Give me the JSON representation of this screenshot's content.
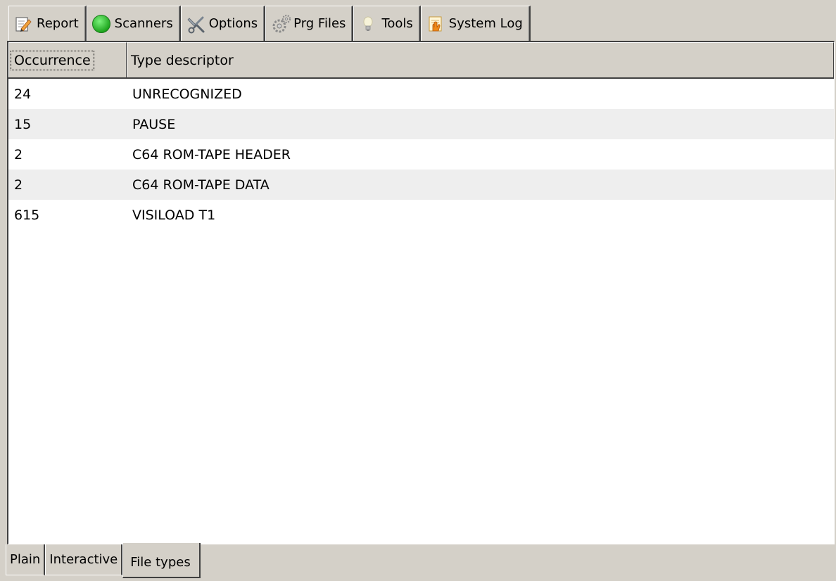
{
  "top_tabs": [
    {
      "label": "Report",
      "icon": "report-icon"
    },
    {
      "label": "Scanners",
      "icon": "scanners-icon"
    },
    {
      "label": "Options",
      "icon": "options-icon"
    },
    {
      "label": "Prg Files",
      "icon": "prg-files-icon"
    },
    {
      "label": "Tools",
      "icon": "tools-icon"
    },
    {
      "label": "System Log",
      "icon": "system-log-icon"
    }
  ],
  "table": {
    "headers": {
      "occurrence": "Occurrence",
      "type": "Type descriptor"
    },
    "rows": [
      {
        "occurrence": "24",
        "type": "UNRECOGNIZED"
      },
      {
        "occurrence": "15",
        "type": "PAUSE"
      },
      {
        "occurrence": "2",
        "type": "C64 ROM-TAPE HEADER"
      },
      {
        "occurrence": "2",
        "type": "C64 ROM-TAPE DATA"
      },
      {
        "occurrence": "615",
        "type": "VISILOAD T1"
      }
    ]
  },
  "bottom_tabs": [
    {
      "label": "Plain"
    },
    {
      "label": "Interactive"
    },
    {
      "label": "File types",
      "active": true
    }
  ],
  "colors": {
    "background": "#d4d0c8",
    "scanner_green": "#22b022",
    "row_alt": "#eeeeee"
  }
}
